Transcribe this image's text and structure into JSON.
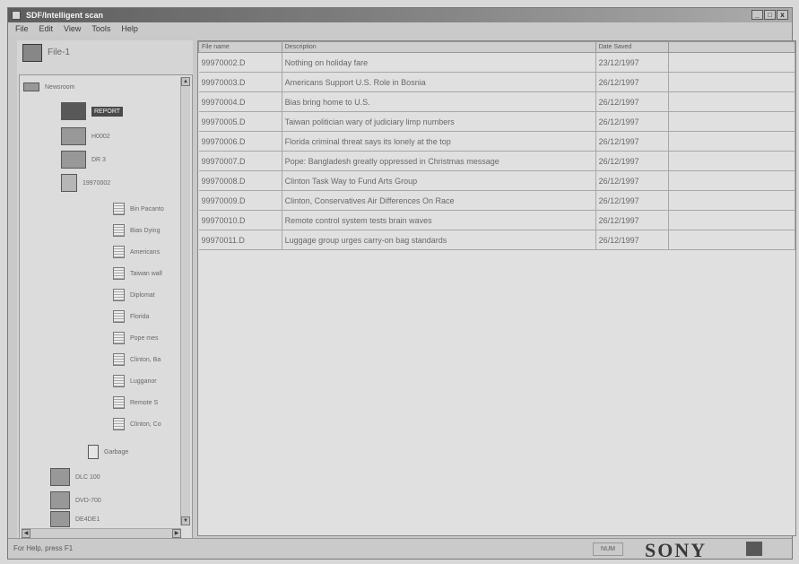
{
  "window": {
    "title": "SDF/Intelligent scan",
    "controls": {
      "minimize": "_",
      "maximize": "□",
      "close": "x"
    }
  },
  "menu": [
    "File",
    "Edit",
    "View",
    "Tools",
    "Help"
  ],
  "left_pane": {
    "header_label": "File-1",
    "tree": [
      {
        "label": "Newsroom",
        "indent": 0
      },
      {
        "label": "REPORT",
        "indent": 1,
        "selected": true
      },
      {
        "label": "H0002",
        "indent": 1
      },
      {
        "label": "DR 3",
        "indent": 1
      },
      {
        "label": "19970002",
        "indent": 1
      },
      {
        "label": "Bin Pacanto",
        "indent": 2
      },
      {
        "label": "Bias Dying",
        "indent": 2
      },
      {
        "label": "Americans",
        "indent": 2
      },
      {
        "label": "Taiwan wall",
        "indent": 2
      },
      {
        "label": "Diplomat",
        "indent": 2
      },
      {
        "label": "Florida ",
        "indent": 2
      },
      {
        "label": "Pope mes",
        "indent": 2
      },
      {
        "label": "Clinton, Ba",
        "indent": 2
      },
      {
        "label": "Lugganor ",
        "indent": 2
      },
      {
        "label": "Remote S",
        "indent": 2
      },
      {
        "label": "Clinton, Co",
        "indent": 2
      },
      {
        "label": "Garbage",
        "indent": 1
      },
      {
        "label": "DLC 100",
        "indent": 0
      },
      {
        "label": "DVD-700",
        "indent": 0
      },
      {
        "label": "DE4DE1",
        "indent": 0
      }
    ]
  },
  "table": {
    "columns": [
      "File name",
      "Description",
      "Date Saved",
      ""
    ],
    "rows": [
      [
        "99970002.D",
        "Nothing on holiday fare",
        "23/12/1997",
        ""
      ],
      [
        "99970003.D",
        "Americans Support U.S. Role in Bosnia",
        "26/12/1997",
        ""
      ],
      [
        "99970004.D",
        "Bias bring home to U.S.",
        "26/12/1997",
        ""
      ],
      [
        "99970005.D",
        "Taiwan politician wary of judiciary limp numbers",
        "26/12/1997",
        ""
      ],
      [
        "99970006.D",
        "Florida criminal threat says its lonely at the top",
        "26/12/1997",
        ""
      ],
      [
        "99970007.D",
        "Pope: Bangladesh greatly oppressed in Christmas message",
        "26/12/1997",
        ""
      ],
      [
        "99970008.D",
        "Clinton Task Way to Fund Arts Group",
        "26/12/1997",
        ""
      ],
      [
        "99970009.D",
        "Clinton, Conservatives Air Differences On Race",
        "26/12/1997",
        ""
      ],
      [
        "99970010.D",
        "Remote control system tests brain waves",
        "26/12/1997",
        ""
      ],
      [
        "99970011.D",
        "Luggage group urges carry-on bag standards",
        "26/12/1997",
        ""
      ]
    ]
  },
  "status": {
    "text": "For Help, press F1",
    "indicator": "NUM",
    "logo": "SONY"
  }
}
